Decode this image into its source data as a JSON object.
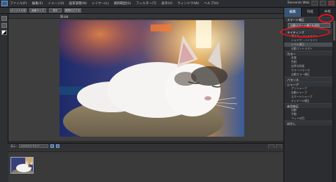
{
  "app": {
    "title_bar_right": "Elements Web"
  },
  "menubar": {
    "items": [
      "ファイル(F)",
      "編集(E)",
      "イメージ(I)",
      "画質調整(N)",
      "レイヤー(L)",
      "選択範囲(S)",
      "フィルター(T)",
      "表示(V)",
      "ウィンドウ(W)",
      "ヘルプ(H)"
    ]
  },
  "optbar": {
    "buttons": [
      "オリジナルを表示",
      "画面サイズ",
      "表示",
      "実際のピクセル"
    ]
  },
  "document": {
    "tab_label": "猫.jpg"
  },
  "panel": {
    "tabs": [
      "編集",
      "作成",
      "共有"
    ],
    "sections": [
      {
        "title": "スマート補正",
        "items": [],
        "button": "自動スマート補正を適用"
      },
      {
        "title": "ライティング",
        "items": [
          "明るさ・コントラスト",
          "シャドウ・ハイライト",
          "レベル補正",
          "自動コントラスト"
        ]
      },
      {
        "title": "カラー",
        "items": [
          "彩度",
          "色相",
          "自然な彩度",
          "カラーバランス",
          "自動カラー補正"
        ]
      },
      {
        "title": "バランス",
        "items": []
      },
      {
        "title": "シャープ",
        "items": [
          "アンシャープ",
          "自動シャープ",
          "スマートシャープ",
          "ディテール補正"
        ]
      },
      {
        "title": "赤目修正",
        "items": [
          "自動",
          "手動",
          "ペットの目"
        ]
      },
      {
        "title": "ぼかし",
        "items": []
      }
    ]
  },
  "binbar": {
    "label": "表示:",
    "select": "プロジェクトビン"
  },
  "colors": {
    "accent": "#3a5574",
    "annotation": "#e0141e"
  }
}
